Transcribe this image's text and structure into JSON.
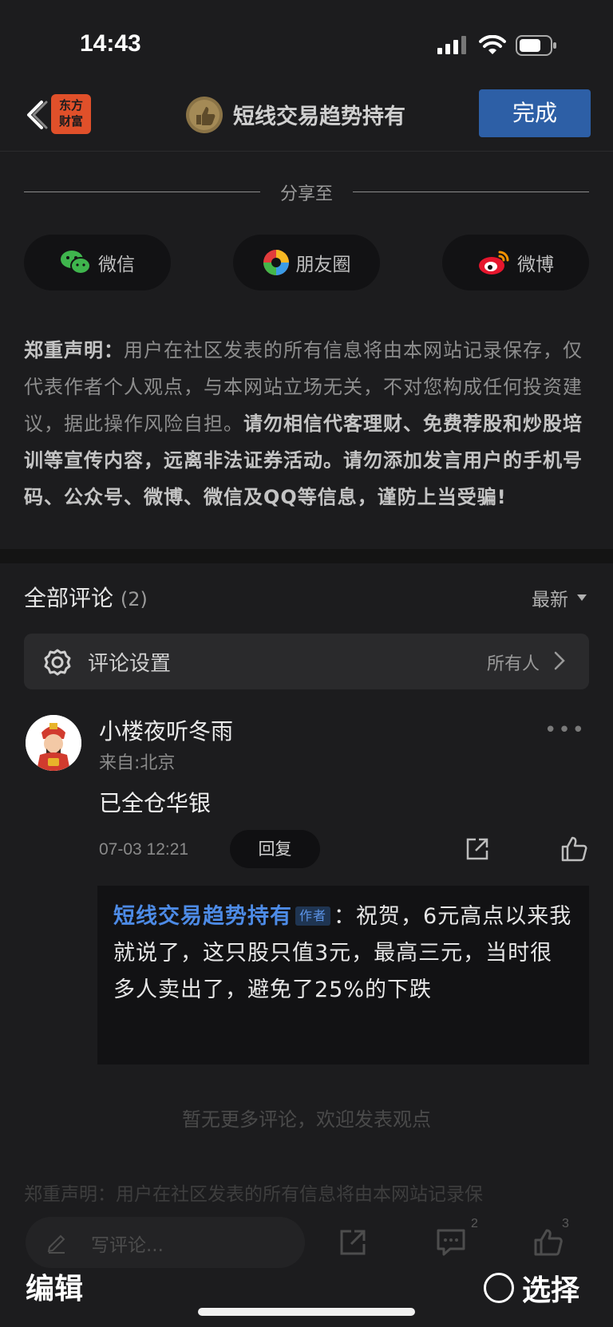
{
  "status_bar": {
    "time": "14:43"
  },
  "nav": {
    "app_logo_line1": "东方",
    "app_logo_line2": "财富",
    "title": "短线交易趋势持有",
    "done_label": "完成"
  },
  "share": {
    "heading": "分享至",
    "options": [
      {
        "label": "微信",
        "icon": "wechat-icon"
      },
      {
        "label": "朋友圈",
        "icon": "moments-icon"
      },
      {
        "label": "微博",
        "icon": "weibo-icon"
      }
    ]
  },
  "disclaimer": {
    "title": "郑重声明：",
    "body": "用户在社区发表的所有信息将由本网站记录保存，仅代表作者个人观点，与本网站立场无关，不对您构成任何投资建议，据此操作风险自担。",
    "warning": "请勿相信代客理财、免费荐股和炒股培训等宣传内容，远离非法证券活动。请勿添加发言用户的手机号码、公众号、微博、微信及QQ等信息，谨防上当受骗!"
  },
  "comments": {
    "header": "全部评论",
    "count": "(2)",
    "sort_label": "最新",
    "settings_label": "评论设置",
    "settings_value": "所有人",
    "items": [
      {
        "author": "小楼夜听冬雨",
        "location": "来自:北京",
        "text": "已全仓华银",
        "date": "07-03 12:21",
        "reply_label": "回复",
        "reply": {
          "author": "短线交易趋势持有",
          "badge": "作者",
          "separator": "：",
          "text": "祝贺，6元高点以来我就说了，这只股只值3元，最高三元，当时很多人卖出了，避免了25%的下跌"
        }
      }
    ],
    "no_more": "暂无更多评论，欢迎发表观点",
    "faded_disclaimer": "郑重声明：用户在社区发表的所有信息将由本网站记录保"
  },
  "bottom_bar": {
    "write_placeholder": "写评论...",
    "comment_badge": "2",
    "like_badge": "3"
  },
  "edit_bar": {
    "edit_label": "编辑",
    "select_label": "选择"
  }
}
